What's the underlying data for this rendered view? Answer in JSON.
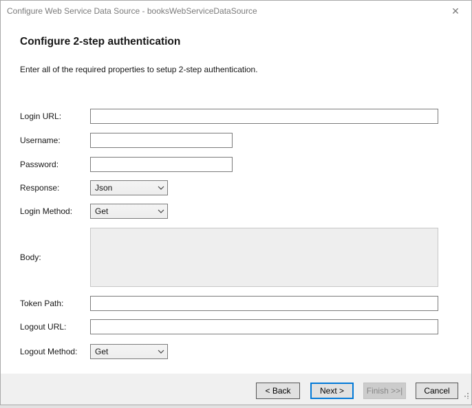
{
  "window": {
    "title": "Configure Web Service Data Source - booksWebServiceDataSource",
    "close_icon": "✕"
  },
  "main": {
    "heading": "Configure 2-step authentication",
    "description": "Enter all of the required properties to setup 2-step authentication."
  },
  "form": {
    "login_url": {
      "label": "Login URL:",
      "value": ""
    },
    "username": {
      "label": "Username:",
      "value": ""
    },
    "password": {
      "label": "Password:",
      "value": ""
    },
    "response": {
      "label": "Response:",
      "selected": "Json"
    },
    "login_method": {
      "label": "Login Method:",
      "selected": "Get"
    },
    "body": {
      "label": "Body:",
      "value": ""
    },
    "token_path": {
      "label": "Token Path:",
      "value": ""
    },
    "logout_url": {
      "label": "Logout URL:",
      "value": ""
    },
    "logout_method": {
      "label": "Logout Method:",
      "selected": "Get"
    }
  },
  "footer": {
    "back": "< Back",
    "next": "Next >",
    "finish": "Finish >>|",
    "cancel": "Cancel"
  },
  "colors": {
    "accent": "#0078d7",
    "titlebar_text": "#7a7a7a",
    "footer_bg": "#f0f0f0",
    "disabled_bg": "#cccccc",
    "control_border": "#7a7a7a"
  }
}
